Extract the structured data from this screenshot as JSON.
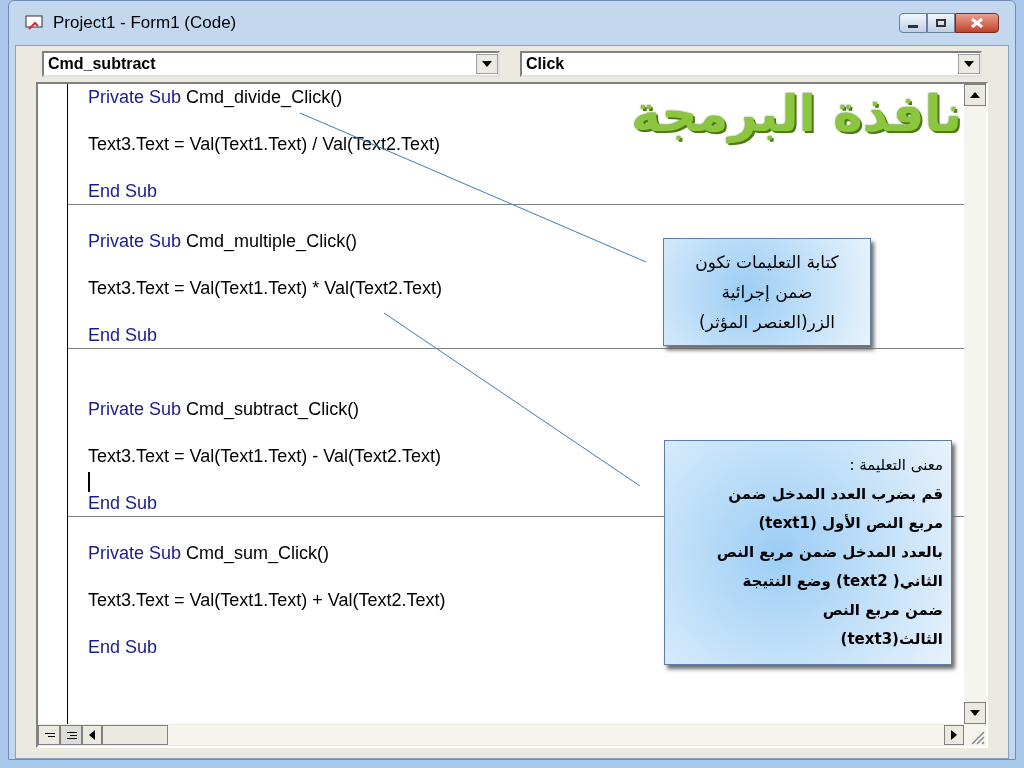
{
  "window": {
    "title": "Project1 - Form1 (Code)"
  },
  "object_dropdown": {
    "value": "Cmd_subtract"
  },
  "procedure_dropdown": {
    "value": "Click"
  },
  "heading": "نافذة البرمجة",
  "procedures": [
    {
      "lines": [
        {
          "kind": "sub",
          "keyword": "Private Sub",
          "rest": "Cmd_divide_Click()"
        },
        {
          "kind": "statement",
          "text": "Text3.Text = Val(Text1.Text) / Val(Text2.Text)"
        },
        {
          "kind": "end",
          "text": "End Sub",
          "caret": false
        }
      ]
    },
    {
      "lines": [
        {
          "kind": "sub",
          "keyword": "Private Sub",
          "rest": "Cmd_multiple_Click()"
        },
        {
          "kind": "statement",
          "text": "Text3.Text = Val(Text1.Text) * Val(Text2.Text)"
        },
        {
          "kind": "end",
          "text": "End Sub",
          "caret": false
        }
      ]
    },
    {
      "lines": [
        {
          "kind": "blank"
        },
        {
          "kind": "sub",
          "keyword": "Private Sub",
          "rest": "Cmd_subtract_Click()"
        },
        {
          "kind": "statement",
          "text": "Text3.Text = Val(Text1.Text) - Val(Text2.Text)"
        },
        {
          "kind": "end",
          "text": "End Sub",
          "caret": true
        }
      ]
    },
    {
      "lines": [
        {
          "kind": "sub",
          "keyword": "Private Sub",
          "rest": "Cmd_sum_Click()"
        },
        {
          "kind": "statement",
          "text": "Text3.Text = Val(Text1.Text) + Val(Text2.Text)"
        },
        {
          "kind": "end",
          "text": "End Sub",
          "caret": false
        }
      ]
    }
  ],
  "callouts": [
    {
      "text": "كتابة التعليمات تكون\nضمن إجرائية\nالزر(العنصر المؤثر)"
    },
    {
      "text": "معنى التعليمة :\n**قم بضرب العدد المدخل ضمن\nمربع النص الأول (text1)\nبالعدد المدخل ضمن مربع النص\nالثاني( text2)  وضع النتيجة\nضمن مربع النص\nالثالث(text3)**"
    }
  ]
}
